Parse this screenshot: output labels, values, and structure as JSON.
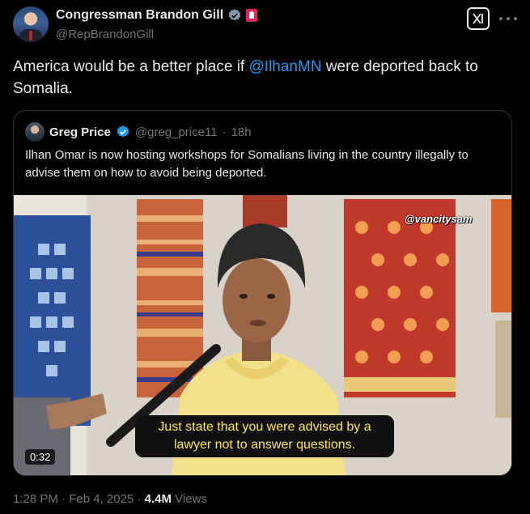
{
  "author": {
    "display_name": "Congressman Brandon Gill",
    "handle": "@RepBrandonGill",
    "avatar_icon": "user-avatar",
    "verified_icon": "verified-gray-badge",
    "affiliation_icon": "government-flag-badge"
  },
  "tweet": {
    "text_before": "America would be a better place if ",
    "mention": "@IlhanMN",
    "text_after": " were deported back to Somalia."
  },
  "quote": {
    "display_name": "Greg Price",
    "handle": "@greg_price11",
    "separator": "·",
    "time_ago": "18h",
    "text": "Ilhan Omar is now hosting workshops for  Somalians living in the country illegally to advise them on how to avoid being deported.",
    "video": {
      "watermark": "@vancitysam",
      "caption_line1": "Just state that you were advised by a",
      "caption_line2": "lawyer not to answer questions.",
      "duration": "0:32"
    }
  },
  "meta": {
    "time": "1:28 PM",
    "dot": "·",
    "date": "Feb 4, 2025",
    "dot2": "·",
    "views_count": "4.4M",
    "views_label": "Views"
  },
  "colors": {
    "background": "#000000",
    "text": "#e7e9ea",
    "muted": "#71767b",
    "link": "#1d9bf0",
    "border": "#2f3336",
    "caption_text": "#ffe94d"
  }
}
